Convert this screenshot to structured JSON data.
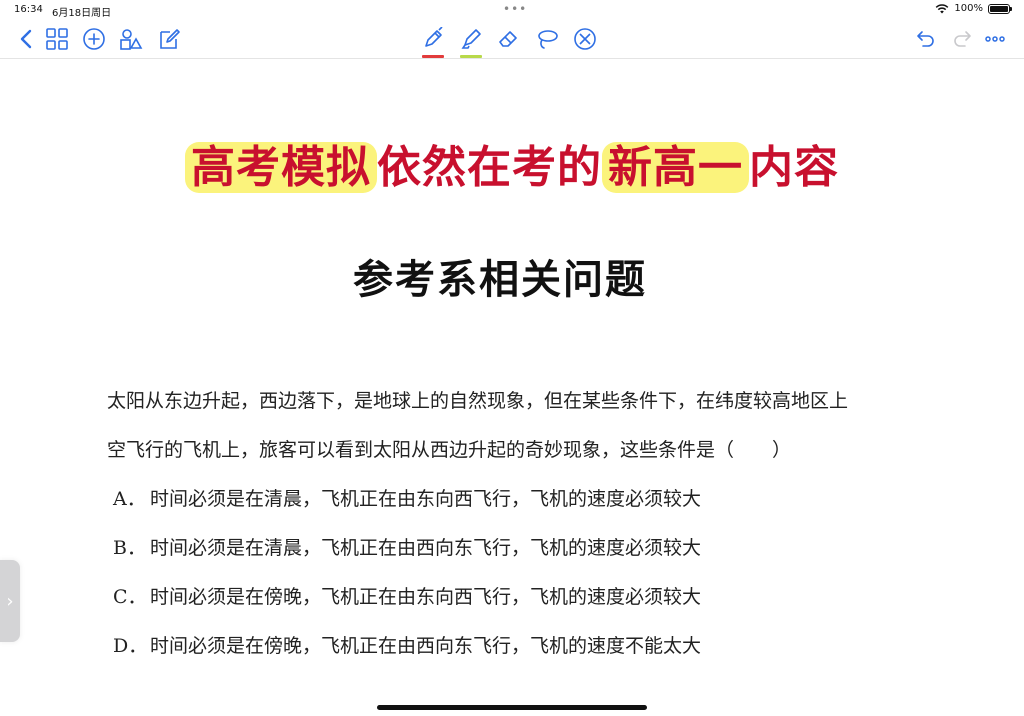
{
  "status": {
    "time": "16:34",
    "date": "6月18日周日",
    "battery_percent_label": "100%",
    "battery_level": 1.0
  },
  "toolbar": {
    "left_icons": [
      "back-chevron-icon",
      "grid-icon",
      "add-circle-icon",
      "shapes-icon",
      "edit-note-icon"
    ],
    "tools": [
      {
        "name": "pen-icon",
        "accent": "#e23b3b",
        "selected": true
      },
      {
        "name": "highlighter-icon",
        "accent": "#b8d94a",
        "selected": false
      },
      {
        "name": "eraser-icon",
        "selected": false
      },
      {
        "name": "lasso-icon",
        "selected": false
      },
      {
        "name": "laser-off-icon",
        "selected": false
      }
    ],
    "right_icons": [
      "undo-icon",
      "redo-icon",
      "more-icon"
    ],
    "icon_color": "#2f6fe4"
  },
  "headline": {
    "part1": "高考模拟",
    "part2": "依然在考的",
    "part3": "新高一",
    "part4": "内容",
    "color": "#c8102e",
    "highlight_color": "#fbf37c"
  },
  "subtitle": "参考系相关问题",
  "question": {
    "line1": "太阳从东边升起，西边落下，是地球上的自然现象，但在某些条件下，在纬度较高地区上",
    "line2": "空飞行的飞机上，旅客可以看到太阳从西边升起的奇妙现象，这些条件是（　　）"
  },
  "options": [
    {
      "letter": "A．",
      "text": "时间必须是在清晨，飞机正在由东向西飞行，飞机的速度必须较大"
    },
    {
      "letter": "B．",
      "text": "时间必须是在清晨，飞机正在由西向东飞行，飞机的速度必须较大"
    },
    {
      "letter": "C．",
      "text": "时间必须是在傍晚，飞机正在由东向西飞行，飞机的速度必须较大"
    },
    {
      "letter": "D．",
      "text": "时间必须是在傍晚，飞机正在由西向东飞行，飞机的速度不能太大"
    }
  ]
}
